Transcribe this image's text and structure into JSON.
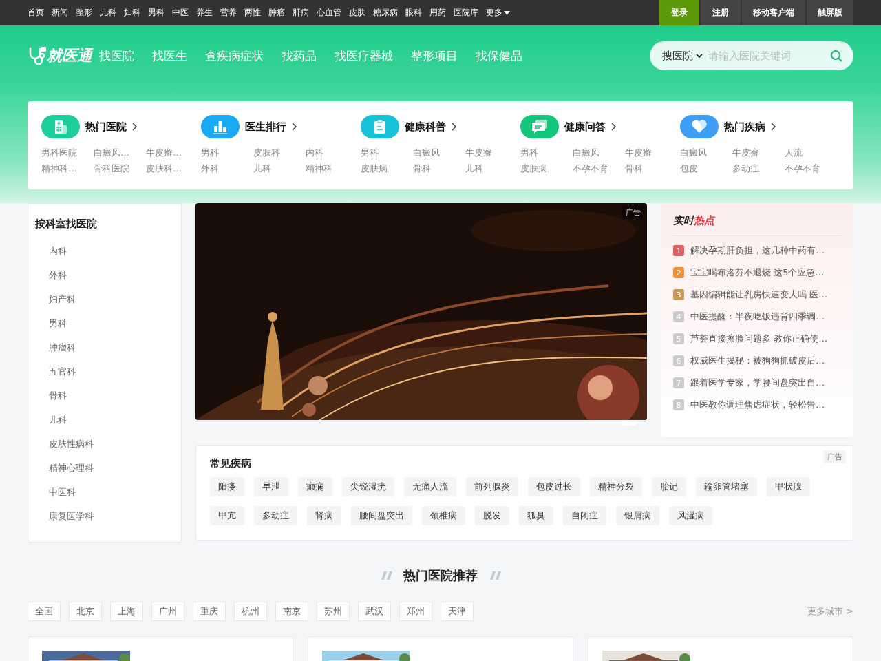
{
  "top_nav": {
    "links": [
      "首页",
      "新闻",
      "整形",
      "儿科",
      "妇科",
      "男科",
      "中医",
      "养生",
      "营养",
      "两性",
      "肿瘤",
      "肝病",
      "心血管",
      "皮肤",
      "糖尿病",
      "眼科",
      "用药",
      "医院库"
    ],
    "more": "更多",
    "account_buttons": [
      {
        "label": "登录",
        "highlighted": true
      },
      {
        "label": "注册",
        "highlighted": false
      },
      {
        "label": "移动客户端",
        "highlighted": false
      },
      {
        "label": "触屏版",
        "highlighted": false
      }
    ]
  },
  "header": {
    "logo": "就医通",
    "nav": [
      "找医院",
      "找医生",
      "查疾病症状",
      "找药品",
      "找医疗器械",
      "整形项目",
      "找保健品"
    ],
    "search": {
      "scope": "搜医院",
      "placeholder": "请输入医院关键词"
    }
  },
  "categories": [
    {
      "kind": "hospital",
      "title": "热门医院",
      "color": "#1ccf9a",
      "links": [
        "男科医院",
        "白癜风…",
        "牛皮癣…",
        "精神科…",
        "骨科医院",
        "皮肤科…"
      ]
    },
    {
      "kind": "ranking",
      "title": "医生排行",
      "color": "#1aa9f5",
      "links": [
        "男科",
        "皮肤科",
        "内科",
        "外科",
        "儿科",
        "精神科"
      ]
    },
    {
      "kind": "science",
      "title": "健康科普",
      "color": "#17c2d8",
      "links": [
        "男科",
        "白癜风",
        "牛皮癣",
        "皮肤病",
        "骨科",
        "儿科"
      ]
    },
    {
      "kind": "qa",
      "title": "健康问答",
      "color": "#14c67c",
      "links": [
        "男科",
        "白癜风",
        "牛皮癣",
        "皮肤病",
        "不孕不育",
        "骨科"
      ]
    },
    {
      "kind": "disease",
      "title": "热门疾病",
      "color": "#3d9ef6",
      "links": [
        "白癜风",
        "牛皮癣",
        "人流",
        "包皮",
        "多动症",
        "不孕不育"
      ]
    }
  ],
  "department_sidebar": {
    "title": "按科室找医院",
    "items": [
      "内科",
      "外科",
      "妇产科",
      "男科",
      "肿瘤科",
      "五官科",
      "骨科",
      "儿科",
      "皮肤性病科",
      "精神心理科",
      "中医科",
      "康复医学科"
    ]
  },
  "banner": {
    "kind": "picture",
    "ad_label": "广告"
  },
  "hot_topics": {
    "title_plain": "实时",
    "title_accent": "热点",
    "items": [
      {
        "rank": "1",
        "color": "#e25f5f",
        "title": "解决孕期肝负担，这几种中药有…"
      },
      {
        "rank": "2",
        "color": "#ef9138",
        "title": "宝宝喝布洛芬不退烧 这5个应急…"
      },
      {
        "rank": "3",
        "color": "#c9995a",
        "title": "基因编辑能让乳房快速变大吗 医…"
      },
      {
        "rank": "4",
        "color": "#cccccc",
        "title": "中医提醒：半夜吃饭违背四季调…"
      },
      {
        "rank": "5",
        "color": "#cccccc",
        "title": "芦荟直接擦脸问题多 教你正确使…"
      },
      {
        "rank": "6",
        "color": "#cccccc",
        "title": "权威医生揭秘：被狗狗抓破皮后…"
      },
      {
        "rank": "7",
        "color": "#cccccc",
        "title": "跟着医学专家，学腰间盘突出自…"
      },
      {
        "rank": "8",
        "color": "#cccccc",
        "title": "中医教你调理焦虑症状，轻松告…"
      }
    ]
  },
  "common_diseases": {
    "title": "常见疾病",
    "ad_label": "广告",
    "tags": [
      "阳痿",
      "早泄",
      "癫痫",
      "尖锐湿疣",
      "无痛人流",
      "前列腺炎",
      "包皮过长",
      "精神分裂",
      "胎记",
      "输卵管堵塞",
      "甲状腺",
      "甲亢",
      "多动症",
      "肾病",
      "腰间盘突出",
      "颈椎病",
      "脱发",
      "狐臭",
      "自闭症",
      "银屑病",
      "风湿病"
    ]
  },
  "hot_hospitals": {
    "title": "热门医院推荐",
    "cities": [
      "全国",
      "北京",
      "上海",
      "广州",
      "重庆",
      "杭州",
      "南京",
      "苏州",
      "武汉",
      "郑州",
      "天津"
    ],
    "more_cities": "更多城市 >",
    "cards": [
      {
        "kind": "picture"
      },
      {
        "kind": "picture"
      },
      {
        "kind": "picture"
      }
    ]
  }
}
